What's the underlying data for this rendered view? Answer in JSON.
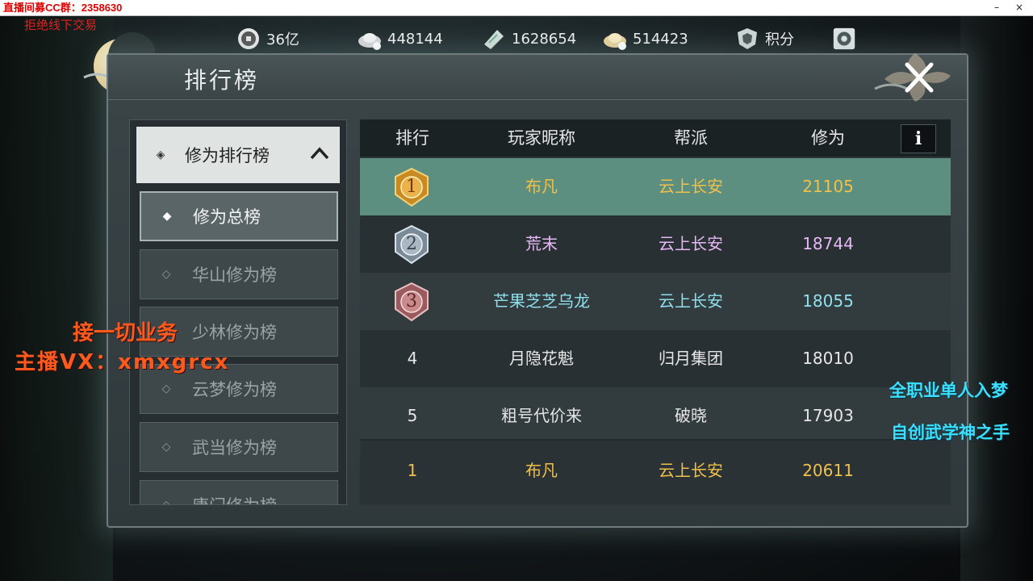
{
  "window": {
    "title": "直播间募CC群：2358630",
    "min": "–",
    "close": "×"
  },
  "overlays": {
    "top_note": "拒绝线下交易",
    "business": "接一切业务",
    "contact": "主播VX：xmxgrcx",
    "right_line1": "全职业单人入梦",
    "right_line2": "自创武学神之手"
  },
  "currency": [
    {
      "icon": "copper-coin-icon",
      "value": "36亿"
    },
    {
      "icon": "silver-ingot-icon",
      "value": "448144"
    },
    {
      "icon": "jade-ticket-icon",
      "value": "1628654"
    },
    {
      "icon": "gold-ingot-icon",
      "value": "514423"
    },
    {
      "icon": "shield-points-icon",
      "value": "积分"
    },
    {
      "icon": "settings-gear-icon",
      "value": ""
    }
  ],
  "panel": {
    "title": "排行榜"
  },
  "sidebar": {
    "header": "修为排行榜",
    "items": [
      {
        "label": "修为总榜",
        "active": true
      },
      {
        "label": "华山修为榜"
      },
      {
        "label": "少林修为榜"
      },
      {
        "label": "云梦修为榜"
      },
      {
        "label": "武当修为榜"
      },
      {
        "label": "唐门修为榜"
      }
    ]
  },
  "table": {
    "headers": [
      "排行",
      "玩家昵称",
      "帮派",
      "修为"
    ],
    "info": "i",
    "rows": [
      {
        "rank": "1",
        "name": "布凡",
        "guild": "云上长安",
        "score": "21105",
        "medal": "gold"
      },
      {
        "rank": "2",
        "name": "荒末",
        "guild": "云上长安",
        "score": "18744",
        "medal": "silver"
      },
      {
        "rank": "3",
        "name": "芒果芝芝乌龙",
        "guild": "云上长安",
        "score": "18055",
        "medal": "bronze"
      },
      {
        "rank": "4",
        "name": "月隐花魁",
        "guild": "归月集团",
        "score": "18010"
      },
      {
        "rank": "5",
        "name": "粗号代价来",
        "guild": "破晓",
        "score": "17903"
      }
    ],
    "self_row": {
      "rank": "1",
      "name": "布凡",
      "guild": "云上长安",
      "score": "20611"
    }
  },
  "colors": {
    "gold_text": "#f0c04a",
    "silver_name": "#e7b8f5",
    "bronze_name": "#8fe0ec",
    "plain_text": "#e6e6e6",
    "self_text": "#f0c04a"
  }
}
